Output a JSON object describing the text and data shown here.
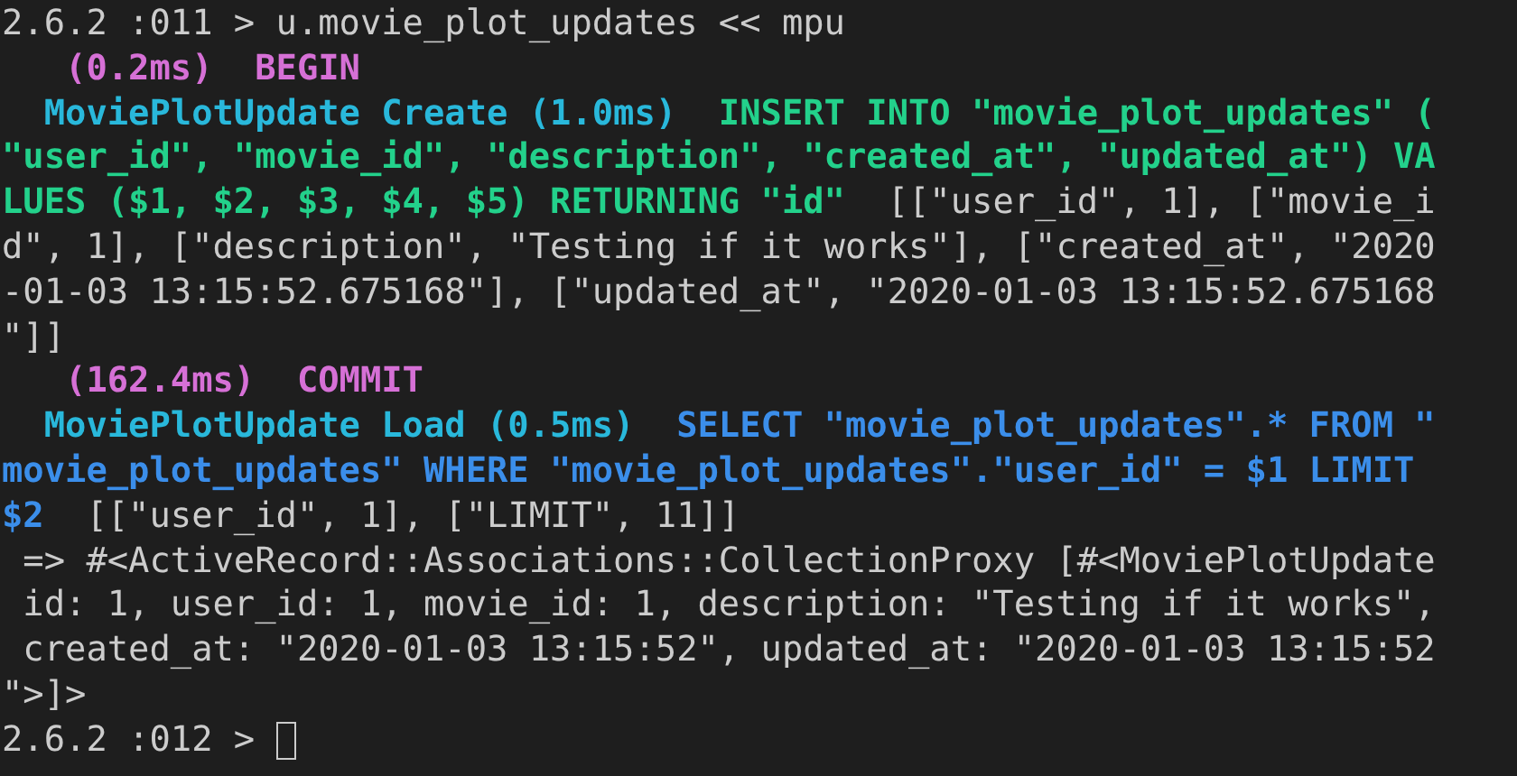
{
  "terminal": {
    "lines": [
      {
        "segments": [
          {
            "kind": "plain",
            "text": "2.6.2 :011 > u.movie_plot_updates << mpu"
          }
        ]
      },
      {
        "segments": [
          {
            "kind": "magenta",
            "text": "   (0.2ms)  BEGIN"
          }
        ]
      },
      {
        "segments": [
          {
            "kind": "cyan",
            "text": "  MoviePlotUpdate Create (1.0ms)"
          },
          {
            "kind": "green",
            "text": "  INSERT INTO \"movie_plot_updates\" ("
          }
        ]
      },
      {
        "segments": [
          {
            "kind": "green",
            "text": "\"user_id\", \"movie_id\", \"description\", \"created_at\", \"updated_at\") VA"
          }
        ]
      },
      {
        "segments": [
          {
            "kind": "green",
            "text": "LUES ($1, $2, $3, $4, $5) RETURNING \"id\""
          },
          {
            "kind": "plain",
            "text": "  [[\"user_id\", 1], [\"movie_i"
          }
        ]
      },
      {
        "segments": [
          {
            "kind": "plain",
            "text": "d\", 1], [\"description\", \"Testing if it works\"], [\"created_at\", \"2020"
          }
        ]
      },
      {
        "segments": [
          {
            "kind": "plain",
            "text": "-01-03 13:15:52.675168\"], [\"updated_at\", \"2020-01-03 13:15:52.675168"
          }
        ]
      },
      {
        "segments": [
          {
            "kind": "plain",
            "text": "\"]]"
          }
        ]
      },
      {
        "segments": [
          {
            "kind": "magenta",
            "text": "   (162.4ms)  COMMIT"
          }
        ]
      },
      {
        "segments": [
          {
            "kind": "cyan",
            "text": "  MoviePlotUpdate Load (0.5ms)"
          },
          {
            "kind": "blue",
            "text": "  SELECT \"movie_plot_updates\".* FROM \""
          }
        ]
      },
      {
        "segments": [
          {
            "kind": "blue",
            "text": "movie_plot_updates\" WHERE \"movie_plot_updates\".\"user_id\" = $1 LIMIT"
          }
        ]
      },
      {
        "segments": [
          {
            "kind": "blue",
            "text": "$2"
          },
          {
            "kind": "plain",
            "text": "  [[\"user_id\", 1], [\"LIMIT\", 11]]"
          }
        ]
      },
      {
        "segments": [
          {
            "kind": "plain",
            "text": " => #<ActiveRecord::Associations::CollectionProxy [#<MoviePlotUpdate"
          }
        ]
      },
      {
        "segments": [
          {
            "kind": "plain",
            "text": " id: 1, user_id: 1, movie_id: 1, description: \"Testing if it works\","
          }
        ]
      },
      {
        "segments": [
          {
            "kind": "plain",
            "text": " created_at: \"2020-01-03 13:15:52\", updated_at: \"2020-01-03 13:15:52"
          }
        ]
      },
      {
        "segments": [
          {
            "kind": "plain",
            "text": "\">]>"
          }
        ]
      },
      {
        "segments": [
          {
            "kind": "plain",
            "text": "2.6.2 :012 >"
          }
        ],
        "cursor": true
      }
    ]
  }
}
